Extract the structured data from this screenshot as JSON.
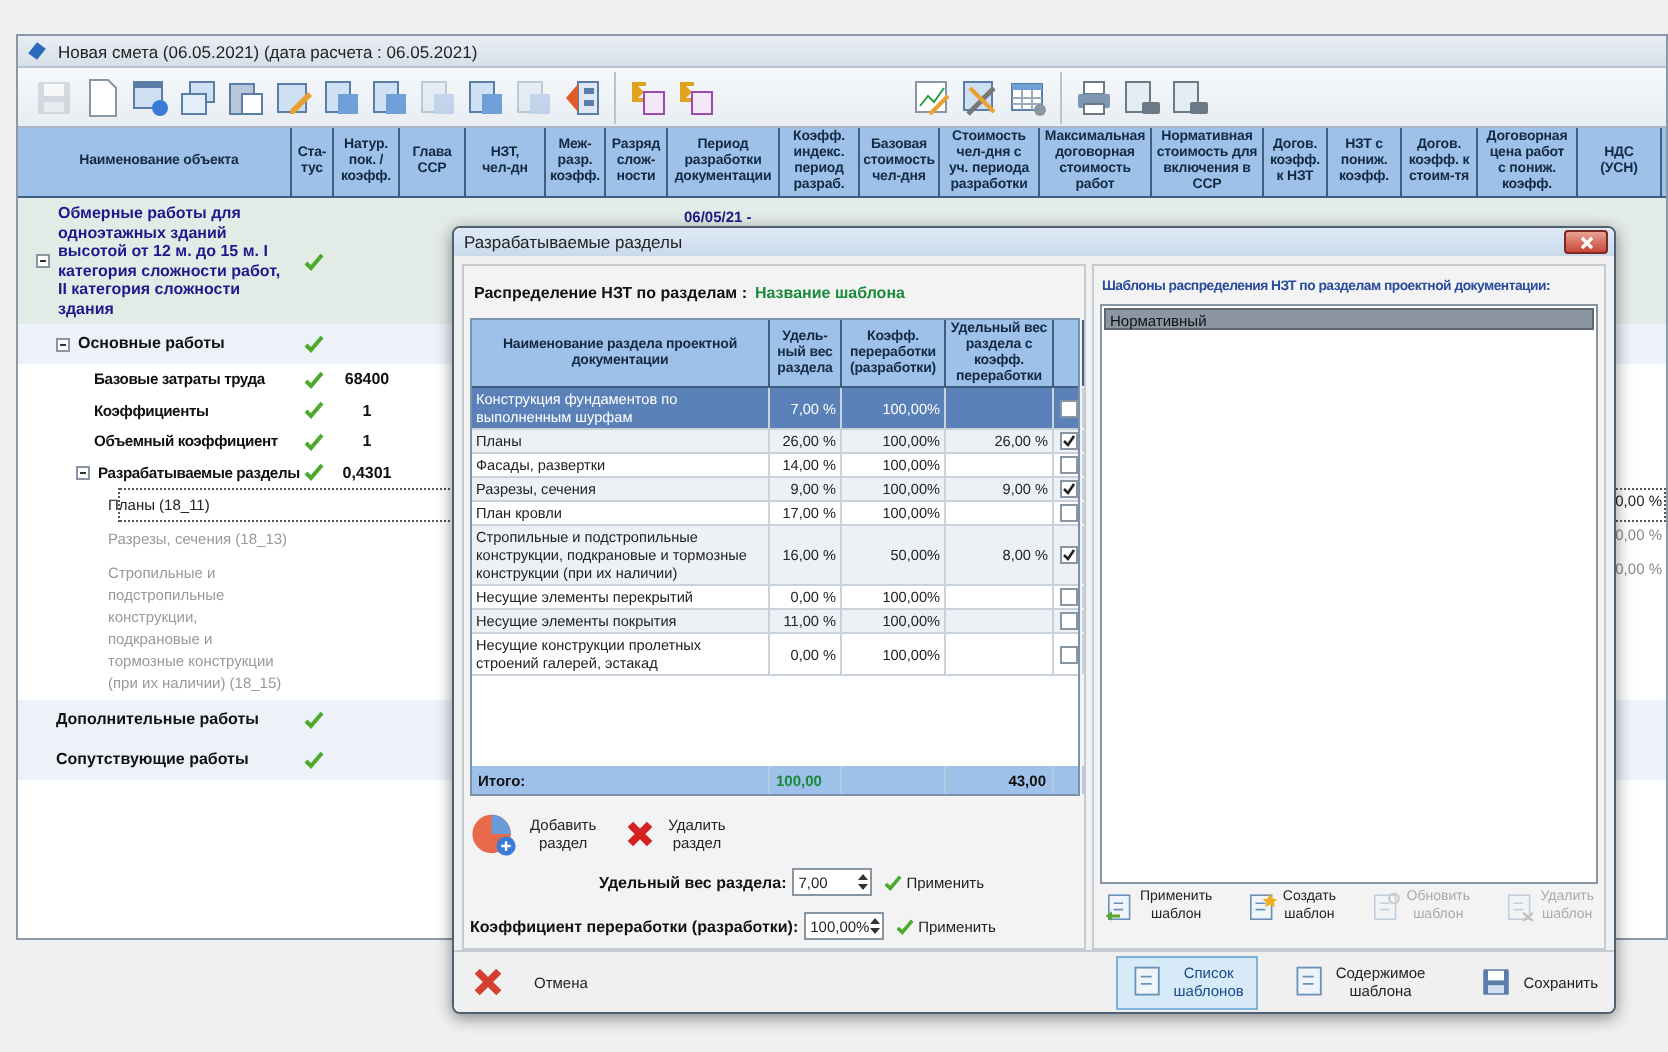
{
  "window": {
    "title": "Новая смета (06.05.2021) (дата расчета : 06.05.2021)"
  },
  "toolbar": [
    {
      "kind": "save",
      "disabled": true
    },
    {
      "kind": "document",
      "disabled": false
    },
    {
      "kind": "window",
      "disabled": false
    },
    {
      "kind": "copy",
      "disabled": false
    },
    {
      "kind": "paste",
      "disabled": false
    },
    {
      "kind": "edit",
      "disabled": false
    },
    {
      "kind": "sheet",
      "disabled": false
    },
    {
      "kind": "sheet",
      "disabled": false
    },
    {
      "kind": "sheet",
      "disabled": true
    },
    {
      "kind": "sheet",
      "disabled": false
    },
    {
      "kind": "sheet",
      "disabled": true
    },
    {
      "kind": "diagram",
      "disabled": false
    },
    {
      "kind": "separator"
    },
    {
      "kind": "sum",
      "disabled": false
    },
    {
      "kind": "sum",
      "disabled": false
    },
    {
      "kind": "gap"
    },
    {
      "kind": "chart",
      "disabled": false
    },
    {
      "kind": "tools",
      "disabled": false
    },
    {
      "kind": "table",
      "disabled": false
    },
    {
      "kind": "separator"
    },
    {
      "kind": "printer",
      "disabled": false
    },
    {
      "kind": "print-doc",
      "disabled": false
    },
    {
      "kind": "print-doc",
      "disabled": false
    }
  ],
  "table": {
    "columns": [
      "Наименование объекта",
      "Ста-\nтус",
      "Натур.\nпок. /\nкоэфф.",
      "Глава\nССР",
      "НЗТ,\nчел-дн",
      "Меж-\nразр.\nкоэфф.",
      "Разряд\nслож-\nности",
      "Период\nразработки\nдокументации",
      "Коэфф.\nиндекс.\nпериод\nразраб.",
      "Базовая\nстоимость\nчел-дня",
      "Стоимость\nчел-дня с\nуч. периода\nразработки",
      "Максимальная\nдоговорная\nстоимость\nработ",
      "Нормативная\nстоимость для\nвключения в\nССР",
      "Догов.\nкоэфф.\nк НЗТ",
      "НЗТ с\nпониж.\nкоэфф.",
      "Догов.\nкоэфф. к\nстоим-тя",
      "Договорная\nцена работ\nс пониж.\nкоэфф.",
      "НДС\n(УСН)"
    ],
    "rows": [
      {
        "kind": "object",
        "name": "Обмерные работы для одноэтажных зданий высотой от 12 м. до 15 м. I категория сложности работ, II категория сложности здания",
        "status": true,
        "expanded": true,
        "period": "06/05/21 -",
        "children": [
          {
            "kind": "group",
            "name": "Основные работы",
            "status": true,
            "expanded": true,
            "children": [
              {
                "kind": "item",
                "name": "Базовые затраты труда",
                "status": true,
                "value": "68400"
              },
              {
                "kind": "item",
                "name": "Коэффициенты",
                "status": true,
                "value": "1"
              },
              {
                "kind": "item",
                "name": "Объемный коэффициент",
                "status": true,
                "value": "1"
              },
              {
                "kind": "item",
                "name": "Разрабатываемые разделы",
                "status": true,
                "value": "0,4301",
                "expanded": true,
                "children": [
                  {
                    "kind": "section",
                    "name": "Планы (18_11)",
                    "selected": true,
                    "value": "0,00 %"
                  },
                  {
                    "kind": "section",
                    "name": "Разрезы, сечения (18_13)",
                    "selected": false,
                    "value": "0,00 %"
                  },
                  {
                    "kind": "section",
                    "name": "Стропильные и подстропильные конструкции, подкрановые и тормозные конструкции (при их наличии) (18_15)",
                    "selected": false,
                    "value": "0,00 %"
                  }
                ]
              }
            ]
          },
          {
            "kind": "group",
            "name": "Дополнительные работы",
            "status": true
          },
          {
            "kind": "group",
            "name": "Сопутствующие работы",
            "status": true
          }
        ]
      }
    ]
  },
  "dialog": {
    "title": "Разрабатываемые разделы",
    "heading": "Распределение НЗТ по  разделам :",
    "template_name": "Название шаблона",
    "columns": [
      "Наименование раздела проектной документации",
      "Удель-\nный вес\nраздела",
      "Коэфф.\nпереработки\n(разработки)",
      "Удельный вес\nраздела с\nкоэфф.\nпереработки"
    ],
    "rows": [
      {
        "name": "Конструкция фундаментов по выполненным шурфам",
        "weight": "7,00 %",
        "coeff": "100,00%",
        "weighted": "",
        "checked": false,
        "selected": true
      },
      {
        "name": "Планы",
        "weight": "26,00 %",
        "coeff": "100,00%",
        "weighted": "26,00 %",
        "checked": true,
        "selected": false
      },
      {
        "name": "Фасады, развертки",
        "weight": "14,00 %",
        "coeff": "100,00%",
        "weighted": "",
        "checked": false,
        "selected": false
      },
      {
        "name": "Разрезы, сечения",
        "weight": "9,00 %",
        "coeff": "100,00%",
        "weighted": "9,00 %",
        "checked": true,
        "selected": false
      },
      {
        "name": "План кровли",
        "weight": "17,00 %",
        "coeff": "100,00%",
        "weighted": "",
        "checked": false,
        "selected": false
      },
      {
        "name": "Стропильные и подстропильные конструкции, подкрановые и тормозные конструкции (при их наличии)",
        "weight": "16,00 %",
        "coeff": "50,00%",
        "weighted": "8,00 %",
        "checked": true,
        "selected": false
      },
      {
        "name": "Несущие элементы перекрытий",
        "weight": "0,00 %",
        "coeff": "100,00%",
        "weighted": "",
        "checked": false,
        "selected": false
      },
      {
        "name": "Несущие элементы покрытия",
        "weight": "11,00 %",
        "coeff": "100,00%",
        "weighted": "",
        "checked": false,
        "selected": false
      },
      {
        "name": "Несущие конструкции пролетных строений галерей, эстакад",
        "weight": "0,00 %",
        "coeff": "100,00%",
        "weighted": "",
        "checked": false,
        "selected": false
      }
    ],
    "total": {
      "label": "Итого:",
      "weight": "100,00",
      "weighted": "43,00"
    },
    "add_button": "Добавить\nраздел",
    "delete_button": "Удалить\nраздел",
    "fields": [
      {
        "label": "Удельный вес раздела:",
        "value": "7,00",
        "apply": "Применить"
      },
      {
        "label": "Коэффициент переработки (разработки):",
        "value": "100,00%",
        "apply": "Применить"
      }
    ],
    "templates_heading": "Шаблоны распределения НЗТ по разделам проектной документации:",
    "templates": [
      {
        "name": "Нормативный",
        "selected": true
      }
    ],
    "template_buttons": [
      {
        "kind": "apply",
        "label": "Применить\nшаблон",
        "disabled": false
      },
      {
        "kind": "create",
        "label": "Создать\nшаблон",
        "disabled": false
      },
      {
        "kind": "update",
        "label": "Обновить\nшаблон",
        "disabled": true
      },
      {
        "kind": "delete",
        "label": "Удалить\nшаблон",
        "disabled": true
      }
    ],
    "cancel": "Отмена",
    "view_buttons": [
      {
        "label": "Список\nшаблонов",
        "selected": true
      },
      {
        "label": "Содержимое\nшаблона",
        "selected": false
      }
    ],
    "save": "Сохранить"
  }
}
